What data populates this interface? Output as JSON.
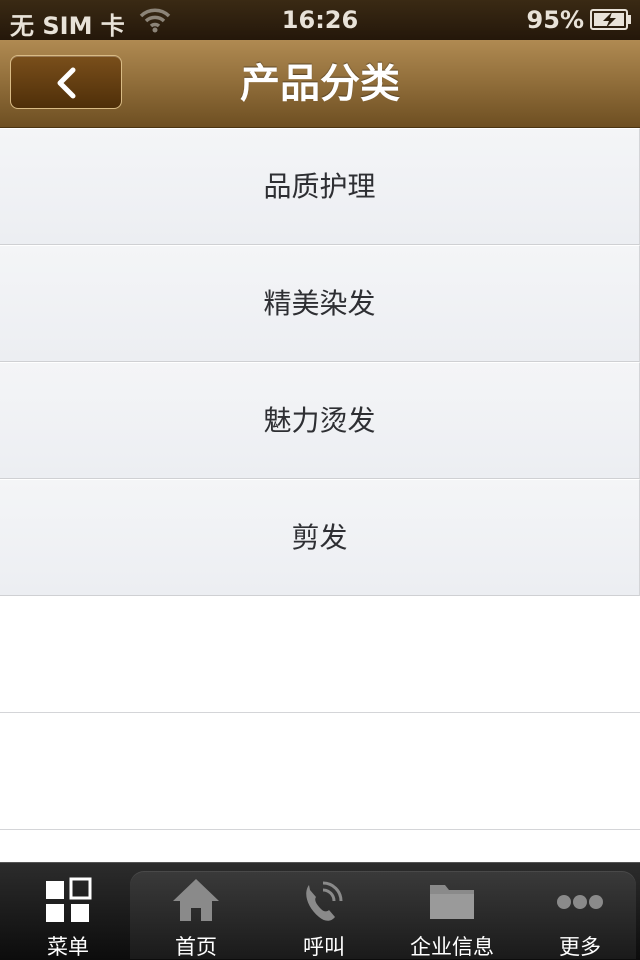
{
  "status_bar": {
    "carrier": "无 SIM 卡",
    "time": "16:26",
    "battery": "95%"
  },
  "nav": {
    "title": "产品分类",
    "back_icon": "chevron-left-icon"
  },
  "categories": [
    {
      "label": "品质护理"
    },
    {
      "label": "精美染发"
    },
    {
      "label": "魅力烫发"
    },
    {
      "label": "剪发"
    }
  ],
  "tabs": [
    {
      "label": "菜单",
      "icon": "grid-icon"
    },
    {
      "label": "首页",
      "icon": "home-icon"
    },
    {
      "label": "呼叫",
      "icon": "phone-icon"
    },
    {
      "label": "企业信息",
      "icon": "folder-icon"
    },
    {
      "label": "更多",
      "icon": "more-icon"
    }
  ],
  "colors": {
    "nav_brown": "#93703c",
    "list_bg": "#f0f1f4",
    "tab_bar": "#1a1a1a"
  }
}
